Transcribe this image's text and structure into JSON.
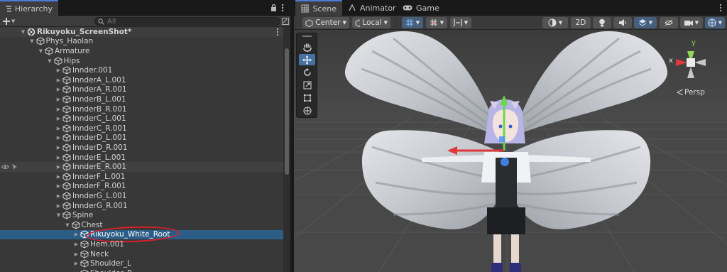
{
  "hierarchy": {
    "tab_label": "Hierarchy",
    "search_placeholder": "All",
    "scene_name": "Rikuyoku_ScreenShot*",
    "nodes": [
      {
        "label": "Phys_Haolan"
      },
      {
        "label": "Armature"
      },
      {
        "label": "Hips"
      },
      {
        "label": "Innder.001"
      },
      {
        "label": "InnderA_L.001"
      },
      {
        "label": "InnderA_R.001"
      },
      {
        "label": "InnderB_L.001"
      },
      {
        "label": "InnderB_R.001"
      },
      {
        "label": "InnderC_L.001"
      },
      {
        "label": "InnderC_R.001"
      },
      {
        "label": "InnderD_L.001"
      },
      {
        "label": "InnderD_R.001"
      },
      {
        "label": "InnderE_L.001"
      },
      {
        "label": "InnderE_R.001"
      },
      {
        "label": "InnderF_L.001"
      },
      {
        "label": "InnderF_R.001"
      },
      {
        "label": "InnderG_L.001"
      },
      {
        "label": "InnderG_R.001"
      },
      {
        "label": "Spine"
      },
      {
        "label": "Chest"
      },
      {
        "label": "Rikuyoku_White_Root"
      },
      {
        "label": "Hem.001"
      },
      {
        "label": "Neck"
      },
      {
        "label": "Shoulder_L"
      },
      {
        "label": "Shoulder_R"
      }
    ]
  },
  "scene": {
    "tabs": [
      {
        "label": "Scene"
      },
      {
        "label": "Animator"
      },
      {
        "label": "Game"
      }
    ],
    "pivot_label": "Center",
    "space_label": "Local",
    "mode_2d_label": "2D",
    "gizmo": {
      "persp_label": "Persp",
      "x_label": "x",
      "y_label": "y"
    }
  },
  "colors": {
    "selection": "#2c5d87",
    "annotation_circle": "#d8202a",
    "accent_tab": "#4d7bd8"
  },
  "icons": [
    "lock-icon",
    "more-icon",
    "add-icon",
    "search-icon",
    "cube-icon",
    "eye-icon",
    "hand-icon",
    "move-icon",
    "rotate-icon",
    "scale-icon",
    "rect-icon",
    "transform-icon",
    "camera-icon"
  ]
}
